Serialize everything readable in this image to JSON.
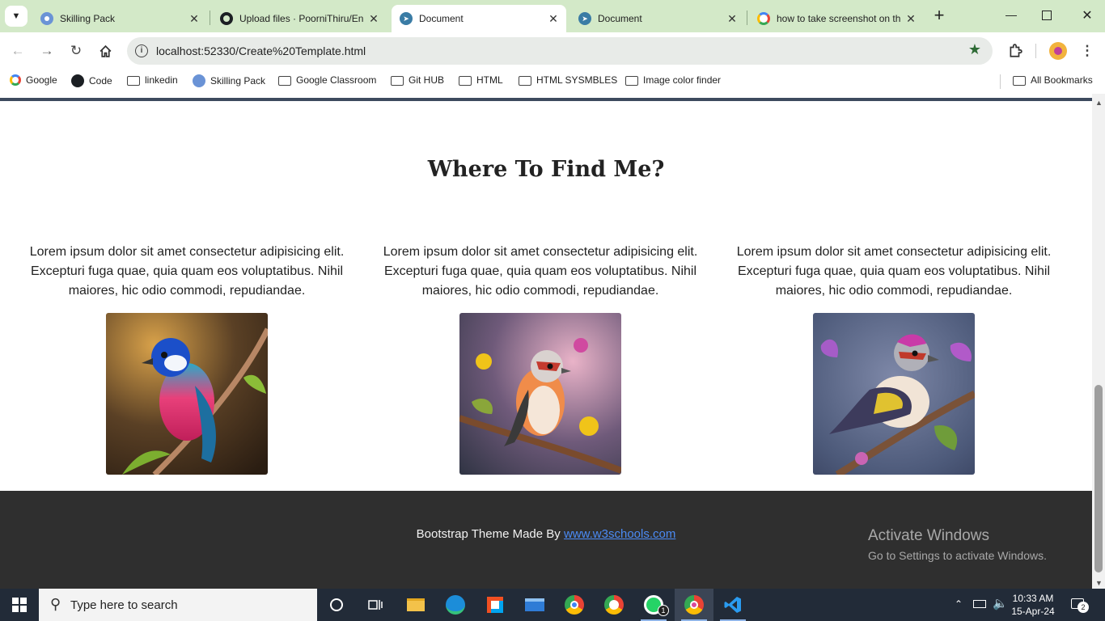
{
  "browser": {
    "tabs": [
      {
        "title": "Skilling Pack",
        "icon": "skilling-pack-icon"
      },
      {
        "title": "Upload files · PoorniThiru/En",
        "icon": "github-icon"
      },
      {
        "title": "Document",
        "icon": "document-icon",
        "active": true
      },
      {
        "title": "Document",
        "icon": "document-icon"
      },
      {
        "title": "how to take screenshot on th",
        "icon": "google-icon"
      }
    ],
    "url": "localhost:52330/Create%20Template.html",
    "bookmarks": [
      "Google",
      "Code",
      "linkedin",
      "Skilling Pack",
      "Google Classroom",
      "Git HUB",
      "HTML",
      "HTML SYSMBLES",
      "Image color finder"
    ],
    "all_bookmarks": "All Bookmarks"
  },
  "page": {
    "heading": "Where To Find Me?",
    "columns": [
      {
        "text": "Lorem ipsum dolor sit amet consectetur adipisicing elit. Excepturi fuga quae, quia quam eos voluptatibus. Nihil maiores, hic odio commodi, repudiandae."
      },
      {
        "text": "Lorem ipsum dolor sit amet consectetur adipisicing elit. Excepturi fuga quae, quia quam eos voluptatibus. Nihil maiores, hic odio commodi, repudiandae."
      },
      {
        "text": "Lorem ipsum dolor sit amet consectetur adipisicing elit. Excepturi fuga quae, quia quam eos voluptatibus. Nihil maiores, hic odio commodi, repudiandae."
      }
    ],
    "footer_text": "Bootstrap Theme Made By ",
    "footer_link": "www.w3schools.com"
  },
  "watermark": {
    "line1": "Activate Windows",
    "line2": "Go to Settings to activate Windows."
  },
  "taskbar": {
    "search_placeholder": "Type here to search",
    "time": "10:33 AM",
    "date": "15-Apr-24",
    "notification_count": "2",
    "whatsapp_badge": "1"
  },
  "colors": {
    "tabbar": "#d3e9c8",
    "footer": "#2f2f2f",
    "link": "#4b8bf5",
    "taskbar": "#222b38"
  }
}
